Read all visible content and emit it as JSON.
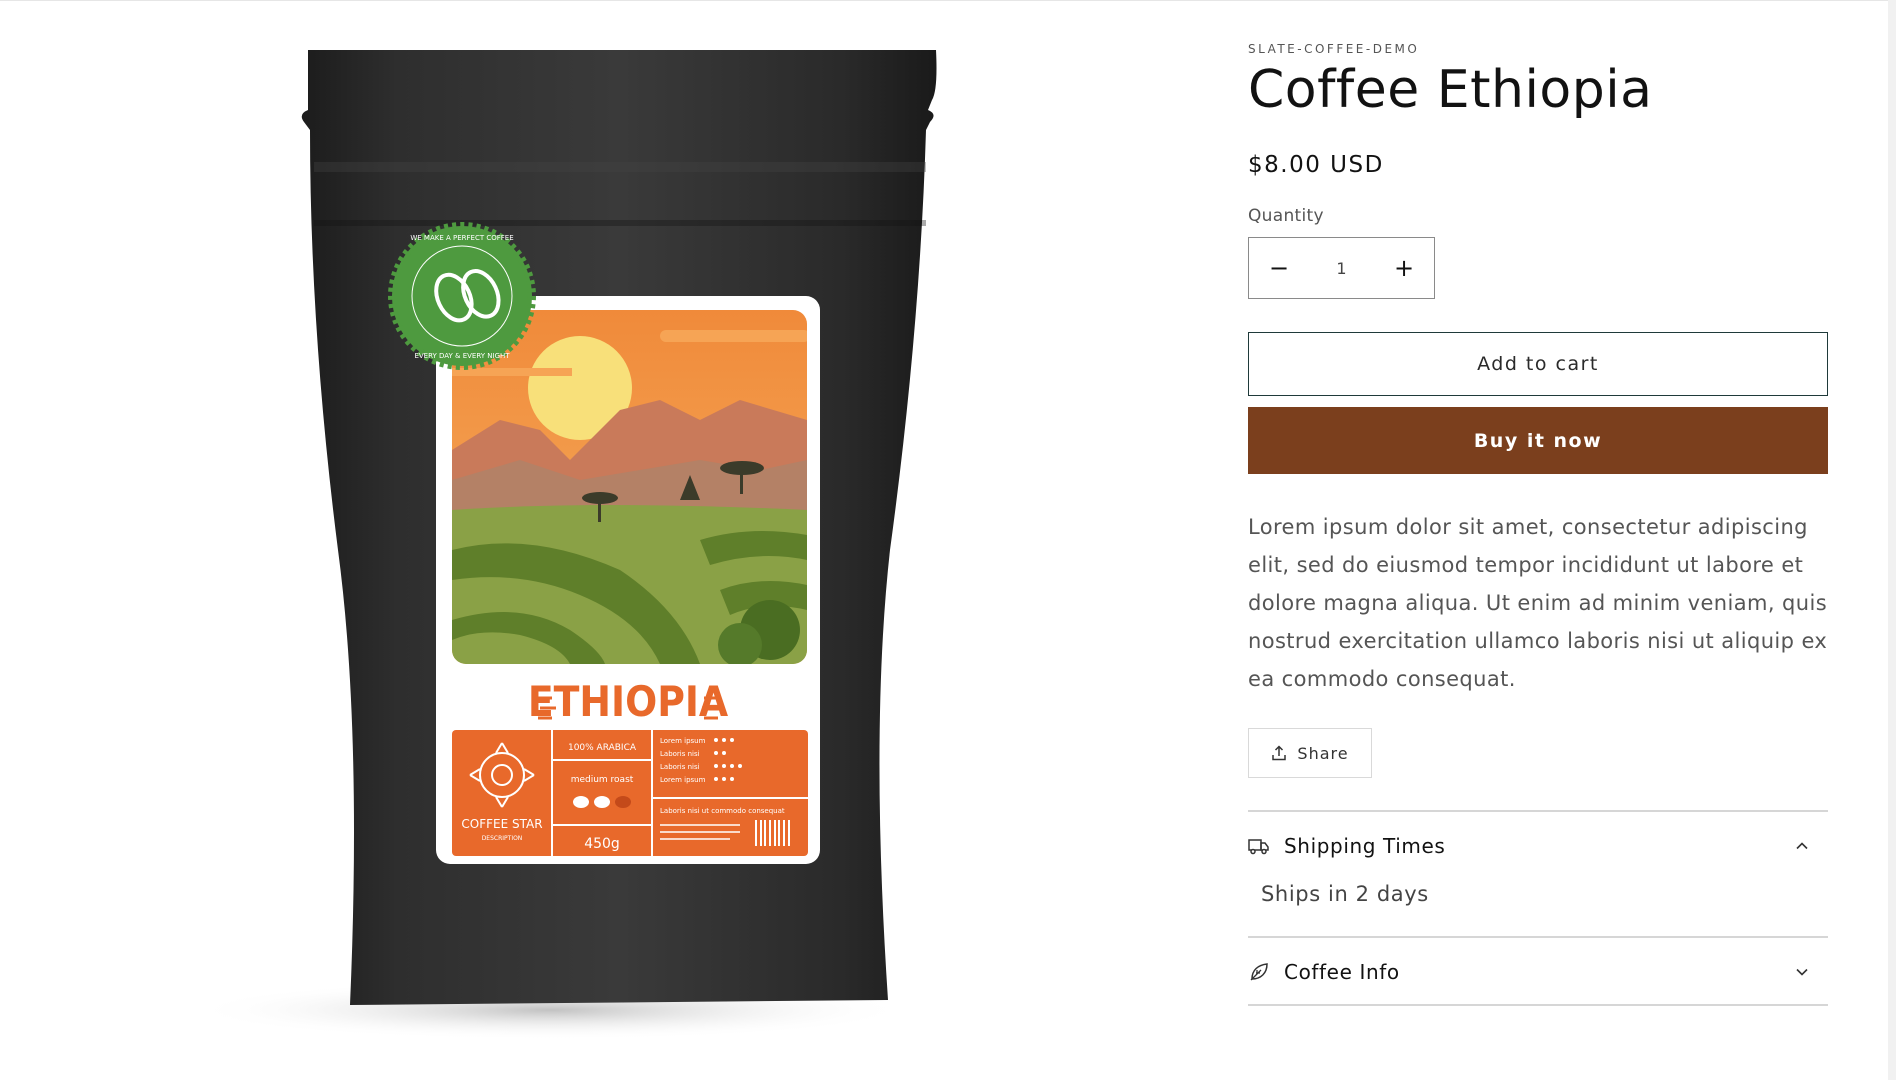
{
  "product": {
    "vendor": "SLATE-COFFEE-DEMO",
    "title": "Coffee Ethiopia",
    "price": "$8.00 USD",
    "quantity_label": "Quantity",
    "quantity_value": "1",
    "decrease_symbol": "−",
    "increase_symbol": "+",
    "add_to_cart_label": "Add to cart",
    "buy_now_label": "Buy it now",
    "description": "Lorem ipsum dolor sit amet, consectetur adipiscing elit, sed do eiusmod tempor incididunt ut labore et dolore magna aliqua. Ut enim ad minim veniam, quis nostrud exercitation ullamco laboris nisi ut aliquip ex ea commodo consequat.",
    "share_label": "Share"
  },
  "accordions": [
    {
      "label": "Shipping Times",
      "icon": "truck-icon",
      "expanded": true,
      "content": "Ships in 2 days"
    },
    {
      "label": "Coffee Info",
      "icon": "leaf-icon",
      "expanded": false,
      "content": ""
    }
  ],
  "package_art": {
    "badge_top_text": "WE MAKE A PERFECT COFFEE",
    "badge_bottom_text": "EVERY DAY & EVERY NIGHT",
    "origin_name": "ETHIOPIA",
    "brand_name": "COFFEE STAR",
    "brand_sub": "DESCRIPTION",
    "arabica_label": "100% ARABICA",
    "roast_label": "medium roast",
    "weight_label": "450g",
    "rating_rows": [
      "Lorem ipsum",
      "Laboris nisi",
      "Laboris nisi",
      "Lorem ipsum"
    ],
    "footer_note": "Laboris nisi ut commodo consequat"
  },
  "colors": {
    "buy_button": "#7b3f1d",
    "bag": "#2a2a2a",
    "label_orange": "#e8692b",
    "badge_green": "#4e9a3f"
  }
}
